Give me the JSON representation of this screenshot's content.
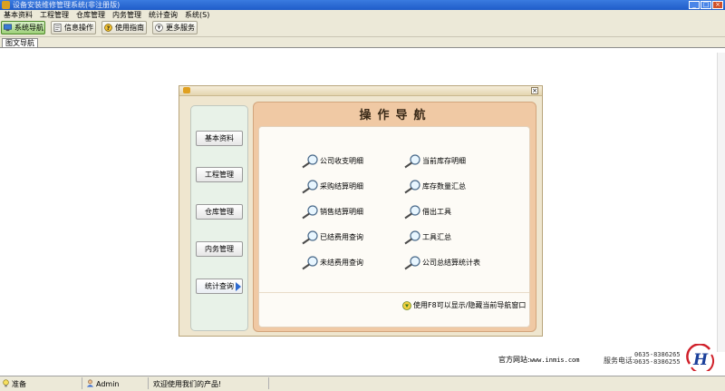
{
  "window": {
    "title": "设备安装维修管理系统(非注册版)"
  },
  "menu": [
    "基本资料",
    "工程管理",
    "仓库管理",
    "内务管理",
    "统计查询",
    "系统(S)"
  ],
  "toolbar": {
    "buttons": [
      {
        "label": "系统导航",
        "icon": "monitor-icon"
      },
      {
        "label": "信息操作",
        "icon": "document-icon"
      },
      {
        "label": "使用指南",
        "icon": "help-icon"
      },
      {
        "label": "更多服务",
        "icon": "service-icon"
      }
    ]
  },
  "tab": {
    "label": "图文导航"
  },
  "dialog": {
    "title": "操作导航",
    "nav": [
      "基本资料",
      "工程管理",
      "仓库管理",
      "内务管理",
      "统计查询"
    ],
    "links_left": [
      "公司收支明细",
      "采购结算明细",
      "销售结算明细",
      "已结费用查询",
      "未结费用查询"
    ],
    "links_right": [
      "当前库存明细",
      "库存数量汇总",
      "借出工具",
      "工具汇总",
      "公司总结算统计表"
    ],
    "hint": "使用F8可以显示/隐藏当前导航窗口"
  },
  "footer": {
    "site_label": "官方网站:",
    "site_url": "www.inmis.com",
    "phone_label": "服务电话:",
    "phone_1": "0635-8386265",
    "phone_2": "0635-8386255"
  },
  "status": {
    "state": "准备",
    "user": "Admin",
    "message": "欢迎使用我们的产品!"
  },
  "colors": {
    "accent_green": "#9ed07a",
    "panel_peach": "#f0c9a4",
    "title_blue": "#1f5cc8"
  }
}
